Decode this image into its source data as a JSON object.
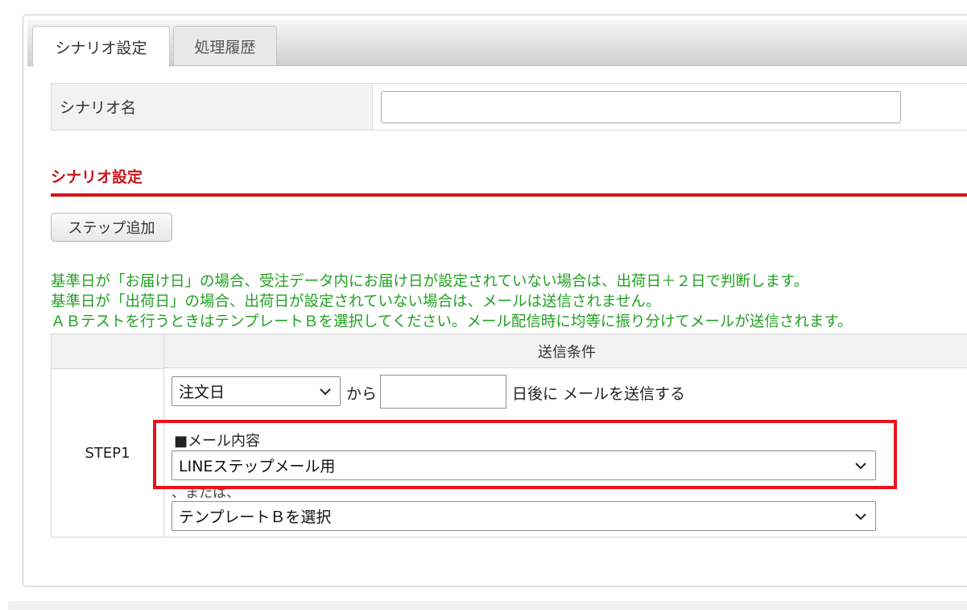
{
  "tabs": {
    "active_label": "シナリオ設定",
    "inactive_label": "処理履歴"
  },
  "scenario_name": {
    "label": "シナリオ名",
    "value": ""
  },
  "section": {
    "title": "シナリオ設定",
    "color": "#c8161d"
  },
  "step_add_label": "ステップ追加",
  "notes": [
    "基準日が「お届け日」の場合、受注データ内にお届け日が設定されていない場合は、出荷日＋２日で判断します。",
    "基準日が「出荷日」の場合、出荷日が設定されていない場合は、メールは送信されません。",
    "ＡＢテストを行うときはテンプレートＢを選択してください。メール配信時に均等に振り分けてメールが送信されます。"
  ],
  "table": {
    "header": "送信条件",
    "step_label": "STEP1",
    "base_date_select": "注文日",
    "from_text": "から",
    "days_value": "",
    "after_text": "日後に メールを送信する",
    "mail_content_label": "■メール内容",
    "mail_template_select": "LINEステップメール用",
    "or_text": "、または、",
    "template_b_select": "テンプレートＢを選択"
  },
  "icons": {
    "dropdown": "chevron-down-icon"
  }
}
